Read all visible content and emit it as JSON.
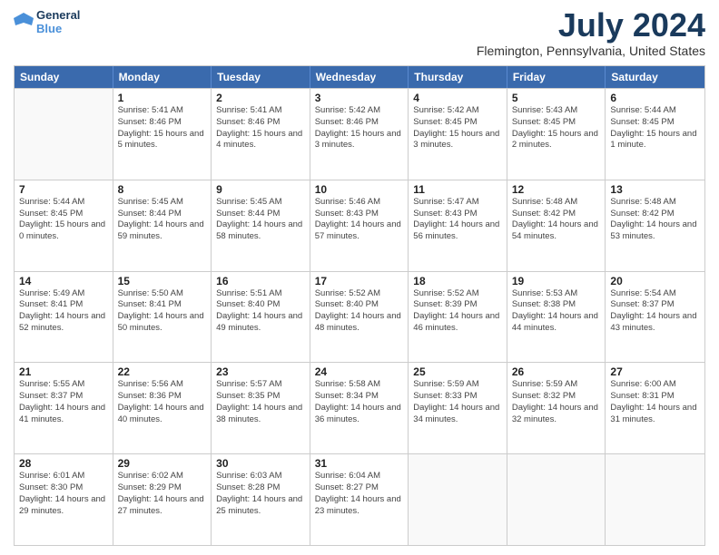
{
  "logo": {
    "line1": "General",
    "line2": "Blue"
  },
  "title": "July 2024",
  "location": "Flemington, Pennsylvania, United States",
  "header_days": [
    "Sunday",
    "Monday",
    "Tuesday",
    "Wednesday",
    "Thursday",
    "Friday",
    "Saturday"
  ],
  "weeks": [
    [
      {
        "day": "",
        "sunrise": "",
        "sunset": "",
        "daylight": ""
      },
      {
        "day": "1",
        "sunrise": "Sunrise: 5:41 AM",
        "sunset": "Sunset: 8:46 PM",
        "daylight": "Daylight: 15 hours and 5 minutes."
      },
      {
        "day": "2",
        "sunrise": "Sunrise: 5:41 AM",
        "sunset": "Sunset: 8:46 PM",
        "daylight": "Daylight: 15 hours and 4 minutes."
      },
      {
        "day": "3",
        "sunrise": "Sunrise: 5:42 AM",
        "sunset": "Sunset: 8:46 PM",
        "daylight": "Daylight: 15 hours and 3 minutes."
      },
      {
        "day": "4",
        "sunrise": "Sunrise: 5:42 AM",
        "sunset": "Sunset: 8:45 PM",
        "daylight": "Daylight: 15 hours and 3 minutes."
      },
      {
        "day": "5",
        "sunrise": "Sunrise: 5:43 AM",
        "sunset": "Sunset: 8:45 PM",
        "daylight": "Daylight: 15 hours and 2 minutes."
      },
      {
        "day": "6",
        "sunrise": "Sunrise: 5:44 AM",
        "sunset": "Sunset: 8:45 PM",
        "daylight": "Daylight: 15 hours and 1 minute."
      }
    ],
    [
      {
        "day": "7",
        "sunrise": "Sunrise: 5:44 AM",
        "sunset": "Sunset: 8:45 PM",
        "daylight": "Daylight: 15 hours and 0 minutes."
      },
      {
        "day": "8",
        "sunrise": "Sunrise: 5:45 AM",
        "sunset": "Sunset: 8:44 PM",
        "daylight": "Daylight: 14 hours and 59 minutes."
      },
      {
        "day": "9",
        "sunrise": "Sunrise: 5:45 AM",
        "sunset": "Sunset: 8:44 PM",
        "daylight": "Daylight: 14 hours and 58 minutes."
      },
      {
        "day": "10",
        "sunrise": "Sunrise: 5:46 AM",
        "sunset": "Sunset: 8:43 PM",
        "daylight": "Daylight: 14 hours and 57 minutes."
      },
      {
        "day": "11",
        "sunrise": "Sunrise: 5:47 AM",
        "sunset": "Sunset: 8:43 PM",
        "daylight": "Daylight: 14 hours and 56 minutes."
      },
      {
        "day": "12",
        "sunrise": "Sunrise: 5:48 AM",
        "sunset": "Sunset: 8:42 PM",
        "daylight": "Daylight: 14 hours and 54 minutes."
      },
      {
        "day": "13",
        "sunrise": "Sunrise: 5:48 AM",
        "sunset": "Sunset: 8:42 PM",
        "daylight": "Daylight: 14 hours and 53 minutes."
      }
    ],
    [
      {
        "day": "14",
        "sunrise": "Sunrise: 5:49 AM",
        "sunset": "Sunset: 8:41 PM",
        "daylight": "Daylight: 14 hours and 52 minutes."
      },
      {
        "day": "15",
        "sunrise": "Sunrise: 5:50 AM",
        "sunset": "Sunset: 8:41 PM",
        "daylight": "Daylight: 14 hours and 50 minutes."
      },
      {
        "day": "16",
        "sunrise": "Sunrise: 5:51 AM",
        "sunset": "Sunset: 8:40 PM",
        "daylight": "Daylight: 14 hours and 49 minutes."
      },
      {
        "day": "17",
        "sunrise": "Sunrise: 5:52 AM",
        "sunset": "Sunset: 8:40 PM",
        "daylight": "Daylight: 14 hours and 48 minutes."
      },
      {
        "day": "18",
        "sunrise": "Sunrise: 5:52 AM",
        "sunset": "Sunset: 8:39 PM",
        "daylight": "Daylight: 14 hours and 46 minutes."
      },
      {
        "day": "19",
        "sunrise": "Sunrise: 5:53 AM",
        "sunset": "Sunset: 8:38 PM",
        "daylight": "Daylight: 14 hours and 44 minutes."
      },
      {
        "day": "20",
        "sunrise": "Sunrise: 5:54 AM",
        "sunset": "Sunset: 8:37 PM",
        "daylight": "Daylight: 14 hours and 43 minutes."
      }
    ],
    [
      {
        "day": "21",
        "sunrise": "Sunrise: 5:55 AM",
        "sunset": "Sunset: 8:37 PM",
        "daylight": "Daylight: 14 hours and 41 minutes."
      },
      {
        "day": "22",
        "sunrise": "Sunrise: 5:56 AM",
        "sunset": "Sunset: 8:36 PM",
        "daylight": "Daylight: 14 hours and 40 minutes."
      },
      {
        "day": "23",
        "sunrise": "Sunrise: 5:57 AM",
        "sunset": "Sunset: 8:35 PM",
        "daylight": "Daylight: 14 hours and 38 minutes."
      },
      {
        "day": "24",
        "sunrise": "Sunrise: 5:58 AM",
        "sunset": "Sunset: 8:34 PM",
        "daylight": "Daylight: 14 hours and 36 minutes."
      },
      {
        "day": "25",
        "sunrise": "Sunrise: 5:59 AM",
        "sunset": "Sunset: 8:33 PM",
        "daylight": "Daylight: 14 hours and 34 minutes."
      },
      {
        "day": "26",
        "sunrise": "Sunrise: 5:59 AM",
        "sunset": "Sunset: 8:32 PM",
        "daylight": "Daylight: 14 hours and 32 minutes."
      },
      {
        "day": "27",
        "sunrise": "Sunrise: 6:00 AM",
        "sunset": "Sunset: 8:31 PM",
        "daylight": "Daylight: 14 hours and 31 minutes."
      }
    ],
    [
      {
        "day": "28",
        "sunrise": "Sunrise: 6:01 AM",
        "sunset": "Sunset: 8:30 PM",
        "daylight": "Daylight: 14 hours and 29 minutes."
      },
      {
        "day": "29",
        "sunrise": "Sunrise: 6:02 AM",
        "sunset": "Sunset: 8:29 PM",
        "daylight": "Daylight: 14 hours and 27 minutes."
      },
      {
        "day": "30",
        "sunrise": "Sunrise: 6:03 AM",
        "sunset": "Sunset: 8:28 PM",
        "daylight": "Daylight: 14 hours and 25 minutes."
      },
      {
        "day": "31",
        "sunrise": "Sunrise: 6:04 AM",
        "sunset": "Sunset: 8:27 PM",
        "daylight": "Daylight: 14 hours and 23 minutes."
      },
      {
        "day": "",
        "sunrise": "",
        "sunset": "",
        "daylight": ""
      },
      {
        "day": "",
        "sunrise": "",
        "sunset": "",
        "daylight": ""
      },
      {
        "day": "",
        "sunrise": "",
        "sunset": "",
        "daylight": ""
      }
    ]
  ]
}
